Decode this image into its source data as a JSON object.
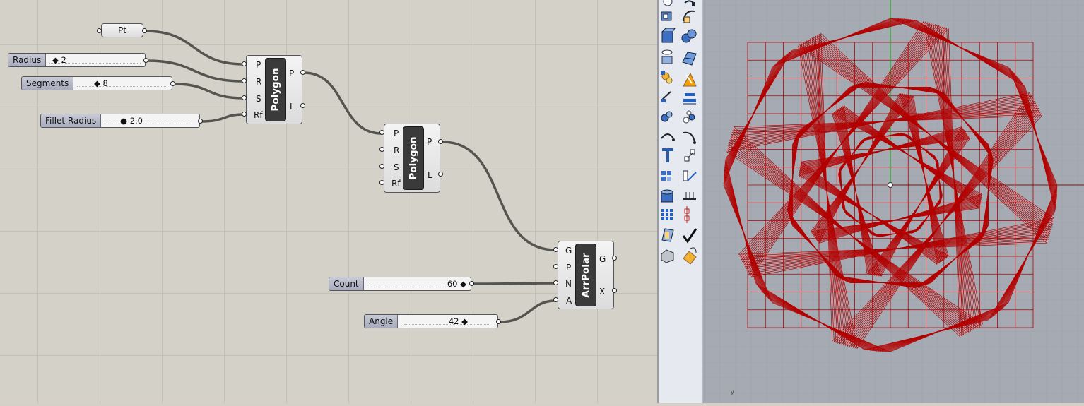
{
  "canvas": {
    "pt_param": {
      "label": "Pt"
    },
    "sliders": {
      "radius": {
        "label": "Radius",
        "value": "2"
      },
      "segments": {
        "label": "Segments",
        "value": "8"
      },
      "fillet_radius": {
        "label": "Fillet Radius",
        "value": "2.0"
      },
      "count": {
        "label": "Count",
        "value": "60"
      },
      "angle": {
        "label": "Angle",
        "value": "42"
      }
    },
    "polygon1": {
      "name": "Polygon",
      "inputs": [
        "P",
        "R",
        "S",
        "Rf"
      ],
      "outputs": [
        "P",
        "L"
      ]
    },
    "polygon2": {
      "name": "Polygon",
      "inputs": [
        "P",
        "R",
        "S",
        "Rf"
      ],
      "outputs": [
        "P",
        "L"
      ]
    },
    "arrpolar": {
      "name": "ArrPolar",
      "inputs": [
        "G",
        "P",
        "N",
        "A"
      ],
      "outputs": [
        "G",
        "X"
      ]
    }
  },
  "toolbar": {
    "icons": [
      "point-icon",
      "curve-icon",
      "box-icon",
      "spheres-icon",
      "cylinder-icon",
      "surface-icon",
      "transform-icon",
      "warning-shape-icon",
      "dimension-icon",
      "align-icon",
      "group-icon",
      "distribute-icon",
      "rotate-icon",
      "arc-icon",
      "text-icon",
      "scale-icon",
      "array-icon",
      "trim-icon",
      "solid-icon",
      "grid-icon",
      "dots-grid-icon",
      "array-linear-icon",
      "bevel-icon",
      "check-icon",
      "block-icon",
      "paint-bucket-icon"
    ]
  },
  "viewport": {
    "axis_label": "y",
    "colors": {
      "geometry": "#b30000",
      "grid": "#b30000",
      "y_axis": "#22aa22",
      "background": "#a6abb3"
    }
  }
}
